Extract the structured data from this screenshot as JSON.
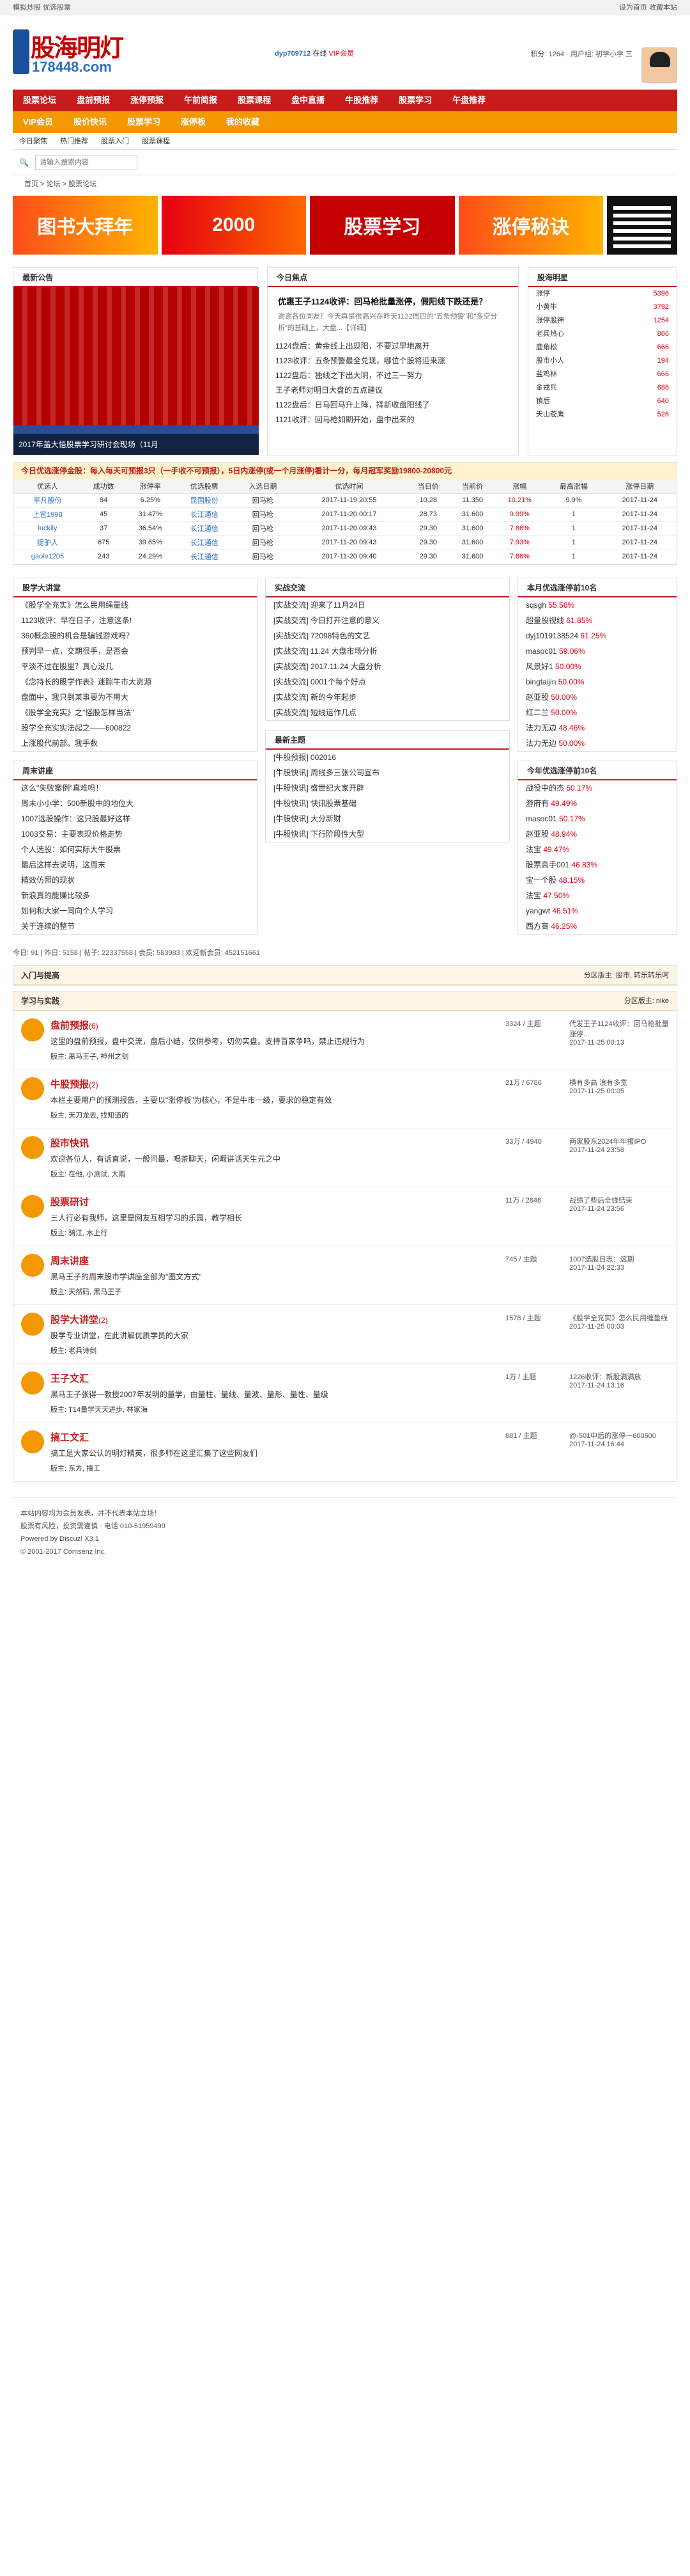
{
  "topbar": {
    "left": "模拟炒股  优选股票",
    "right": "设为首页  收藏本站"
  },
  "user": {
    "name": "dyp709712",
    "status": "在线",
    "level": "VIP会员"
  },
  "userbar": {
    "points": "积分: 1264",
    "label": "用户组: 初学小学 三"
  },
  "logo": {
    "title": "股海明灯",
    "sub": "178448.com"
  },
  "nav": [
    "股票论坛",
    "盘前预报",
    "涨停预报",
    "午前简报",
    "股票课程",
    "盘中直播",
    "牛股推荐",
    "股票学习",
    "午盘推荐"
  ],
  "nav2": [
    "VIP会员",
    "股价快讯",
    "股票学习",
    "涨停板",
    "我的收藏"
  ],
  "subnav": [
    "今日聚焦",
    "热门推荐",
    "股票入门",
    "股票课程"
  ],
  "search": {
    "placeholder": "请输入搜索内容"
  },
  "breadcrumb": "首页 > 论坛 > 股票论坛",
  "banners": [
    "图书大拜年",
    "2000",
    "股票学习",
    "涨停秘诀",
    "二维码"
  ],
  "sections": {
    "latest_post": "最新公告",
    "today_focus": "今日焦点",
    "star_rank": "股海明星"
  },
  "slide_caption": "2017年盖大悟股票学习研讨会现场（11月",
  "news": {
    "headline": "优惠王子1124收评：回马枪批量涨停，假阳线下跌还是？",
    "summary": "谢谢各位同友！今天真是很高兴在昨天1122周四的\"五条预警\"和\"多空分析\"的基础上，大盘...【详细】",
    "items": [
      "1124盘后：黄金线上出现阳，不要过早地离开",
      "1123收评：五条预警最全兑现，哪位个股将迎来涨",
      "1122盘后：独线之下出大阴，不过三一努力",
      "王子老师对明日大盘的五点建议",
      "1122盘后：日马回马升上阵，择新收盘阳线了",
      "1121收评：回马枪如期开始，盘中出来的"
    ]
  },
  "rank": [
    {
      "name": "涨停",
      "score": "5396"
    },
    {
      "name": "小黄牛",
      "score": "3792"
    },
    {
      "name": "涨停股神",
      "score": "1254"
    },
    {
      "name": "老兵热心",
      "score": "866"
    },
    {
      "name": "鹿角松",
      "score": "666"
    },
    {
      "name": "股市小人",
      "score": "194"
    },
    {
      "name": "盐鸡林",
      "score": "666"
    },
    {
      "name": "金戎兵",
      "score": "686"
    },
    {
      "name": "镇后",
      "score": "640"
    },
    {
      "name": "天山苍鹰",
      "score": "526"
    }
  ],
  "stocktable": {
    "title": "今日优选涨停金股：每入每天可预报3只（一手收不可预报），5日内涨停(或一个月涨停)看计一分，每月冠军奖励19800-20800元",
    "headers": [
      "优选人",
      "成功数",
      "涨停率",
      "优选股票",
      "入选日期",
      "优选时间",
      "当日价",
      "当前价",
      "涨幅",
      "最高涨幅",
      "涨停日期"
    ],
    "rows": [
      [
        "平凡股份",
        "84",
        "6.25%",
        "昆国股份",
        "回马枪",
        "2017-11-19 20:55",
        "10.28",
        "11.350",
        "10.21%",
        "9.9%",
        "2017-11-24"
      ],
      [
        "上官1998",
        "45",
        "31.47%",
        "长江通信",
        "回马枪",
        "2017-11-20 00:17",
        "28.73",
        "31.600",
        "9.99%",
        "1",
        "2017-11-24"
      ],
      [
        "luckily",
        "37",
        "36.54%",
        "长江通信",
        "回马枪",
        "2017-11-20 09:43",
        "29.30",
        "31.600",
        "7.86%",
        "1",
        "2017-11-24"
      ],
      [
        "捉驴人",
        "675",
        "39.65%",
        "长江通信",
        "回马枪",
        "2017-11-20 09:43",
        "29.30",
        "31.600",
        "7.93%",
        "1",
        "2017-11-24"
      ],
      [
        "gaole1205",
        "243",
        "24.29%",
        "长江通信",
        "回马枪",
        "2017-11-20 09:40",
        "29.30",
        "31.600",
        "7.86%",
        "1",
        "2017-11-24"
      ]
    ]
  },
  "left_lists": [
    {
      "title": "股学大讲堂",
      "items": [
        "《股学全充实》怎么民用绳量线",
        "1123收评：早在日子，注意这条!",
        "360概念股的机会是骗钱游戏吗？",
        "预判早一点，交期很手，是否会",
        "平淡不过在股里？真心没几",
        "《念持长的股学作表》迷踪牛市大资源",
        "盘面中，我只到某事要为不用大",
        "《股学全充实》之\"怪股怎样当法\"",
        "股学全充实实法起之——600822",
        "上涨股代前部。我手数"
      ]
    },
    {
      "title": "周末讲座",
      "items": [
        "这么\"失败案例\"真难吗！",
        "周末小小学：500新股中的地位大",
        "1007选股操作：这只股最好这样",
        "1003交易：主要表现价格走势",
        "个人选股：如何实际大牛股票",
        "最后这样去说明，这周末",
        "精效仿照的现状",
        "新浪真的能赚比较多",
        "如何和大家一同向个人学习",
        "关于连续的整节"
      ]
    }
  ],
  "right_lists": [
    {
      "title": "本月优选涨停前10名",
      "items": [
        [
          "sqsgh",
          "55.56%"
        ],
        [
          "超量股视线",
          "61.85%"
        ],
        [
          "dyj1019138524",
          "61.25%"
        ],
        [
          "masoc01",
          "59.06%"
        ],
        [
          "风景好1",
          "50.00%"
        ],
        [
          "bingtaijin",
          "50.00%"
        ],
        [
          "赵亚股",
          "50.00%"
        ],
        [
          "红二兰",
          "50.00%"
        ],
        [
          "法力无边",
          "48.46%"
        ],
        [
          "法力无边",
          "50.00%"
        ]
      ]
    },
    {
      "title": "今年优选涨停前10名",
      "items": [
        [
          "战役中的杰",
          "50.17%"
        ],
        [
          "游府有",
          "49.49%"
        ],
        [
          "masoc01",
          "50.17%"
        ],
        [
          "赵亚股",
          "48.94%"
        ],
        [
          "法宝",
          "49.47%"
        ],
        [
          "股票高手001",
          "46.83%"
        ],
        [
          "宝一个股",
          "48.15%"
        ],
        [
          "法宝",
          "47.50%"
        ],
        [
          "yangwt",
          "46.51%"
        ],
        [
          "西方高",
          "46.25%"
        ]
      ]
    }
  ],
  "mid_lists": [
    {
      "title": "实战交流",
      "items": [
        "[实战交流] 迎来了11月24日",
        "[实战交流] 今日打开注意的意义",
        "[实战交流] 72098特色的文艺",
        "[实战交流] 11.24 大盘市场分析",
        "[实战交流] 2017.11.24 大盘分析",
        "[实战交流] 0001个每个好点",
        "[实战交流] 新的今年起步",
        "[实战交流] 短线运作几点"
      ]
    },
    {
      "title": "最新主题",
      "items": [
        "[牛股预报] 002016",
        "[牛股快讯] 周线多三张公司宣布",
        "[牛股快讯] 盛世纪大家开辟",
        "[牛股快讯] 快讯股票基础",
        "[牛股快讯] 大分新财",
        "[牛股快讯] 下行阶段性大型"
      ]
    }
  ],
  "stats": {
    "posts": "今日: 91",
    "yesterday": "昨日: 5158",
    "total": "帖子: 22337558",
    "members": "会员: 583983",
    "new": "欢迎新会员: 452151661"
  },
  "forum_groups": [
    {
      "title": "入门与提高",
      "moderators": "分区版主: 股市, 转乐转乐呵"
    },
    {
      "title": "学习与实践",
      "moderators": "分区版主: nike"
    }
  ],
  "forums": [
    {
      "title": "盘前预报",
      "count": "(6)",
      "desc": "这里的盘前预报，盘中交流，盘后小结，仅供参考，切勿实盘。支持百家争鸣，禁止违规行为",
      "mod": "版主: 黑马王子, 神州之剑",
      "stat": "3324 / 主题",
      "last": "代发王子1124收评：回马枪批量涨停...",
      "time": "2017-11-25 00:13"
    },
    {
      "title": "牛股预报",
      "count": "(2)",
      "desc": "本栏主要用户的预测报告，主要以\"涨停板\"为核心，不是牛市一级，要求的稳定有效",
      "mod": "版主: 天刀龙去, 找知道的",
      "stat": "21万 / 6786",
      "last": "横有多高 浪有多宽",
      "time": "2017-11-25 00:05"
    },
    {
      "title": "股市快讯",
      "count": "",
      "desc": "欢迎各位人，有话直说，一般问最，喝茶聊天，闲暇讲话天生元之中",
      "mod": "版主: 在他, 小测试, 大雨",
      "stat": "33万 / 4940",
      "last": "两家股东2024年年报IPO",
      "time": "2017-11-24 23:58"
    },
    {
      "title": "股票研讨",
      "count": "",
      "desc": "三人行必有我师，这里是网友互相学习的乐园，教学相长",
      "mod": "版主: 骑江, 水上行",
      "stat": "11万 / 2646",
      "last": "战绩了些后全线结束",
      "time": "2017-11-24 23:56"
    },
    {
      "title": "周末讲座",
      "count": "",
      "desc": "黑马王子的周末股市学讲座全部为\"图文方式\"",
      "mod": "版主: 天然码, 黑马王子",
      "stat": "745 / 主题",
      "last": "1007选股日志：这期",
      "time": "2017-11-24 22:33"
    },
    {
      "title": "股学大讲堂",
      "count": "(2)",
      "desc": "股学专业讲堂，在此讲解优质学员的大家",
      "mod": "版主: 老兵诗剑",
      "stat": "1578 / 主题",
      "last": "《股学全充实》怎么民用缠量线",
      "time": "2017-11-25 00:03"
    },
    {
      "title": "王子文汇",
      "count": "",
      "desc": "黑马王子张得一教授2007年发明的量学，由量柱、量线、量波、量形、量性、量级",
      "mod": "版主: T14量学天天进步, 林家海",
      "stat": "1万 / 主题",
      "last": "1226收评：新股满满放",
      "time": "2017-11-24 13:16"
    },
    {
      "title": "搞工文汇",
      "count": "",
      "desc": "搞工是大家公认的明灯精英，很多师在这里汇集了这些网友们",
      "mod": "版主: 东方, 搞工",
      "stat": "881 / 主题",
      "last": "@-501中后的涨停一600600",
      "time": "2017-11-24 16:44"
    }
  ],
  "footer": {
    "line1": "本站内容均为会员发表，并不代表本站立场！",
    "line2": "股票有风险，投资需谨慎 · 电话 010-51959499",
    "power": "Powered by Discuz! X3.1",
    "copy": "© 2001-2017 Comsenz Inc."
  }
}
